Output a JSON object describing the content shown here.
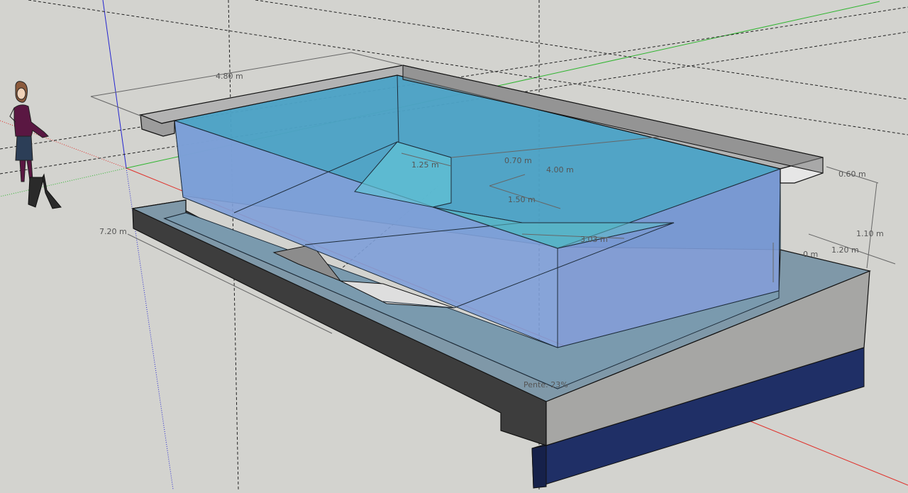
{
  "viewport": {
    "background": "#d3d3cf",
    "axes": {
      "red": "#e0302a",
      "green": "#2fb52f",
      "blue": "#2525d0"
    }
  },
  "model": {
    "water_color": "#4fb0d6",
    "coping_color": "#a9a9a9",
    "foundation_color": "#1f2f66",
    "concrete_dark": "#3d3d3d"
  },
  "dimensions": {
    "length_top": "4.80 m",
    "side_length": "7.20 m",
    "step_width": "1.25 m",
    "step_depth": "0.70 m",
    "main_length": "4.00 m",
    "step_run": "1.50 m",
    "ramp_length": "3.03 m",
    "coping_width": "0.60 m",
    "wall_height": "1.10 m",
    "shelf_width": "1.20 m",
    "partial": "0 m"
  },
  "labels": {
    "slope": "Pente: 23%"
  },
  "figure": {
    "name": "person-scale-figure"
  }
}
